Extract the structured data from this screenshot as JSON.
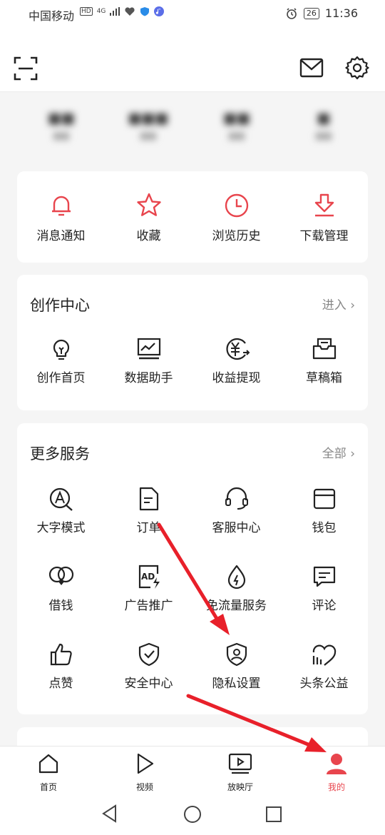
{
  "status_bar": {
    "carrier": "中国移动",
    "badges": [
      "HD",
      "4G"
    ],
    "battery": "26",
    "time": "11:36"
  },
  "top_bar": {
    "icons": [
      "scan-icon",
      "mail-icon",
      "gear-icon"
    ]
  },
  "quick_actions": [
    {
      "label": "消息通知",
      "icon": "bell-icon"
    },
    {
      "label": "收藏",
      "icon": "star-icon"
    },
    {
      "label": "浏览历史",
      "icon": "clock-icon"
    },
    {
      "label": "下载管理",
      "icon": "download-icon"
    }
  ],
  "creation_center": {
    "title": "创作中心",
    "more": "进入 ›",
    "items": [
      {
        "label": "创作首页",
        "icon": "lightbulb-icon"
      },
      {
        "label": "数据助手",
        "icon": "chart-monitor-icon"
      },
      {
        "label": "收益提现",
        "icon": "yuan-icon"
      },
      {
        "label": "草稿箱",
        "icon": "draft-box-icon"
      }
    ]
  },
  "more_services": {
    "title": "更多服务",
    "more": "全部 ›",
    "items": [
      {
        "label": "大字模式",
        "icon": "large-font-icon"
      },
      {
        "label": "订单",
        "icon": "order-icon"
      },
      {
        "label": "客服中心",
        "icon": "headset-icon"
      },
      {
        "label": "钱包",
        "icon": "wallet-icon"
      },
      {
        "label": "借钱",
        "icon": "loan-icon"
      },
      {
        "label": "广告推广",
        "icon": "ad-icon"
      },
      {
        "label": "免流量服务",
        "icon": "data-free-icon"
      },
      {
        "label": "评论",
        "icon": "comment-icon"
      },
      {
        "label": "点赞",
        "icon": "thumbs-up-icon"
      },
      {
        "label": "安全中心",
        "icon": "shield-check-icon"
      },
      {
        "label": "隐私设置",
        "icon": "privacy-shield-icon"
      },
      {
        "label": "头条公益",
        "icon": "charity-icon"
      }
    ]
  },
  "tab_bar": [
    {
      "label": "首页",
      "icon": "home-icon",
      "active": false
    },
    {
      "label": "视频",
      "icon": "play-icon",
      "active": false
    },
    {
      "label": "放映厅",
      "icon": "screening-room-icon",
      "active": false
    },
    {
      "label": "我的",
      "icon": "profile-icon",
      "active": true
    }
  ],
  "colors": {
    "accent": "#e8454d",
    "annotation_arrow": "#e8202a"
  }
}
